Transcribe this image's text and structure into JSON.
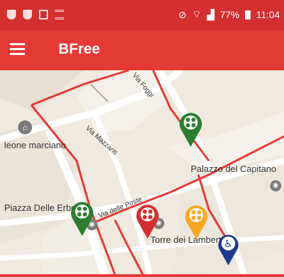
{
  "status_bar": {
    "signal_text": "77%",
    "time": "11:04"
  },
  "app_bar": {
    "title": "BFree"
  },
  "map": {
    "labels": {
      "street_1": "Via Mazzanti",
      "street_2": "Via delle Poste",
      "street_3": "Via Foggi",
      "place_leone": "leone marciano",
      "place_palazzo": "Palazzo del Capitano",
      "place_piazza": "Piazza Delle Erbe",
      "place_torre": "Torre dei Lamberti"
    },
    "pins": [
      {
        "name": "green-accessibility-pin",
        "color": "#2e7d32"
      },
      {
        "name": "green-accessibility-pin-2",
        "color": "#2e7d32"
      },
      {
        "name": "red-accessibility-pin",
        "color": "#d32f2f"
      },
      {
        "name": "yellow-accessibility-pin",
        "color": "#f9a825"
      },
      {
        "name": "blue-wheelchair-pin",
        "color": "#1e3a8a"
      }
    ]
  }
}
